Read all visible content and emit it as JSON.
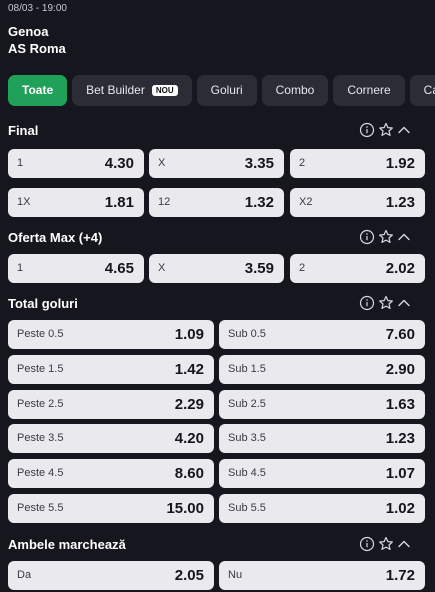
{
  "match": {
    "datetime": "08/03 - 19:00",
    "home": "Genoa",
    "away": "AS Roma"
  },
  "tabs": [
    {
      "label": "Toate",
      "active": true
    },
    {
      "label": "Bet Builder",
      "badge": "NOU"
    },
    {
      "label": "Goluri"
    },
    {
      "label": "Combo"
    },
    {
      "label": "Cornere"
    },
    {
      "label": "Cartonașe"
    }
  ],
  "sections": {
    "final": {
      "title": "Final",
      "rows": [
        [
          {
            "label": "1",
            "odd": "4.30"
          },
          {
            "label": "X",
            "odd": "3.35"
          },
          {
            "label": "2",
            "odd": "1.92"
          }
        ],
        [
          {
            "label": "1X",
            "odd": "1.81"
          },
          {
            "label": "12",
            "odd": "1.32"
          },
          {
            "label": "X2",
            "odd": "1.23"
          }
        ]
      ]
    },
    "oferta_max": {
      "title": "Oferta Max (+4)",
      "rows": [
        [
          {
            "label": "1",
            "odd": "4.65"
          },
          {
            "label": "X",
            "odd": "3.59"
          },
          {
            "label": "2",
            "odd": "2.02"
          }
        ]
      ]
    },
    "total_goluri": {
      "title": "Total goluri",
      "rows": [
        [
          {
            "label": "Peste 0.5",
            "odd": "1.09"
          },
          {
            "label": "Sub 0.5",
            "odd": "7.60"
          }
        ],
        [
          {
            "label": "Peste 1.5",
            "odd": "1.42"
          },
          {
            "label": "Sub 1.5",
            "odd": "2.90"
          }
        ],
        [
          {
            "label": "Peste 2.5",
            "odd": "2.29"
          },
          {
            "label": "Sub 2.5",
            "odd": "1.63"
          }
        ],
        [
          {
            "label": "Peste 3.5",
            "odd": "4.20"
          },
          {
            "label": "Sub 3.5",
            "odd": "1.23"
          }
        ],
        [
          {
            "label": "Peste 4.5",
            "odd": "8.60"
          },
          {
            "label": "Sub 4.5",
            "odd": "1.07"
          }
        ],
        [
          {
            "label": "Peste 5.5",
            "odd": "15.00"
          },
          {
            "label": "Sub 5.5",
            "odd": "1.02"
          }
        ]
      ]
    },
    "ambele": {
      "title": "Ambele marchează",
      "rows": [
        [
          {
            "label": "Da",
            "odd": "2.05"
          },
          {
            "label": "Nu",
            "odd": "1.72"
          }
        ]
      ]
    }
  },
  "icons": {
    "info": "info-icon",
    "favorite": "star-icon",
    "collapse": "chevron-up-icon"
  },
  "colors": {
    "background": "#16161f",
    "tab": "#2c2c36",
    "active_tab": "#1fa15a",
    "odd_cell": "#e9e9ee"
  }
}
